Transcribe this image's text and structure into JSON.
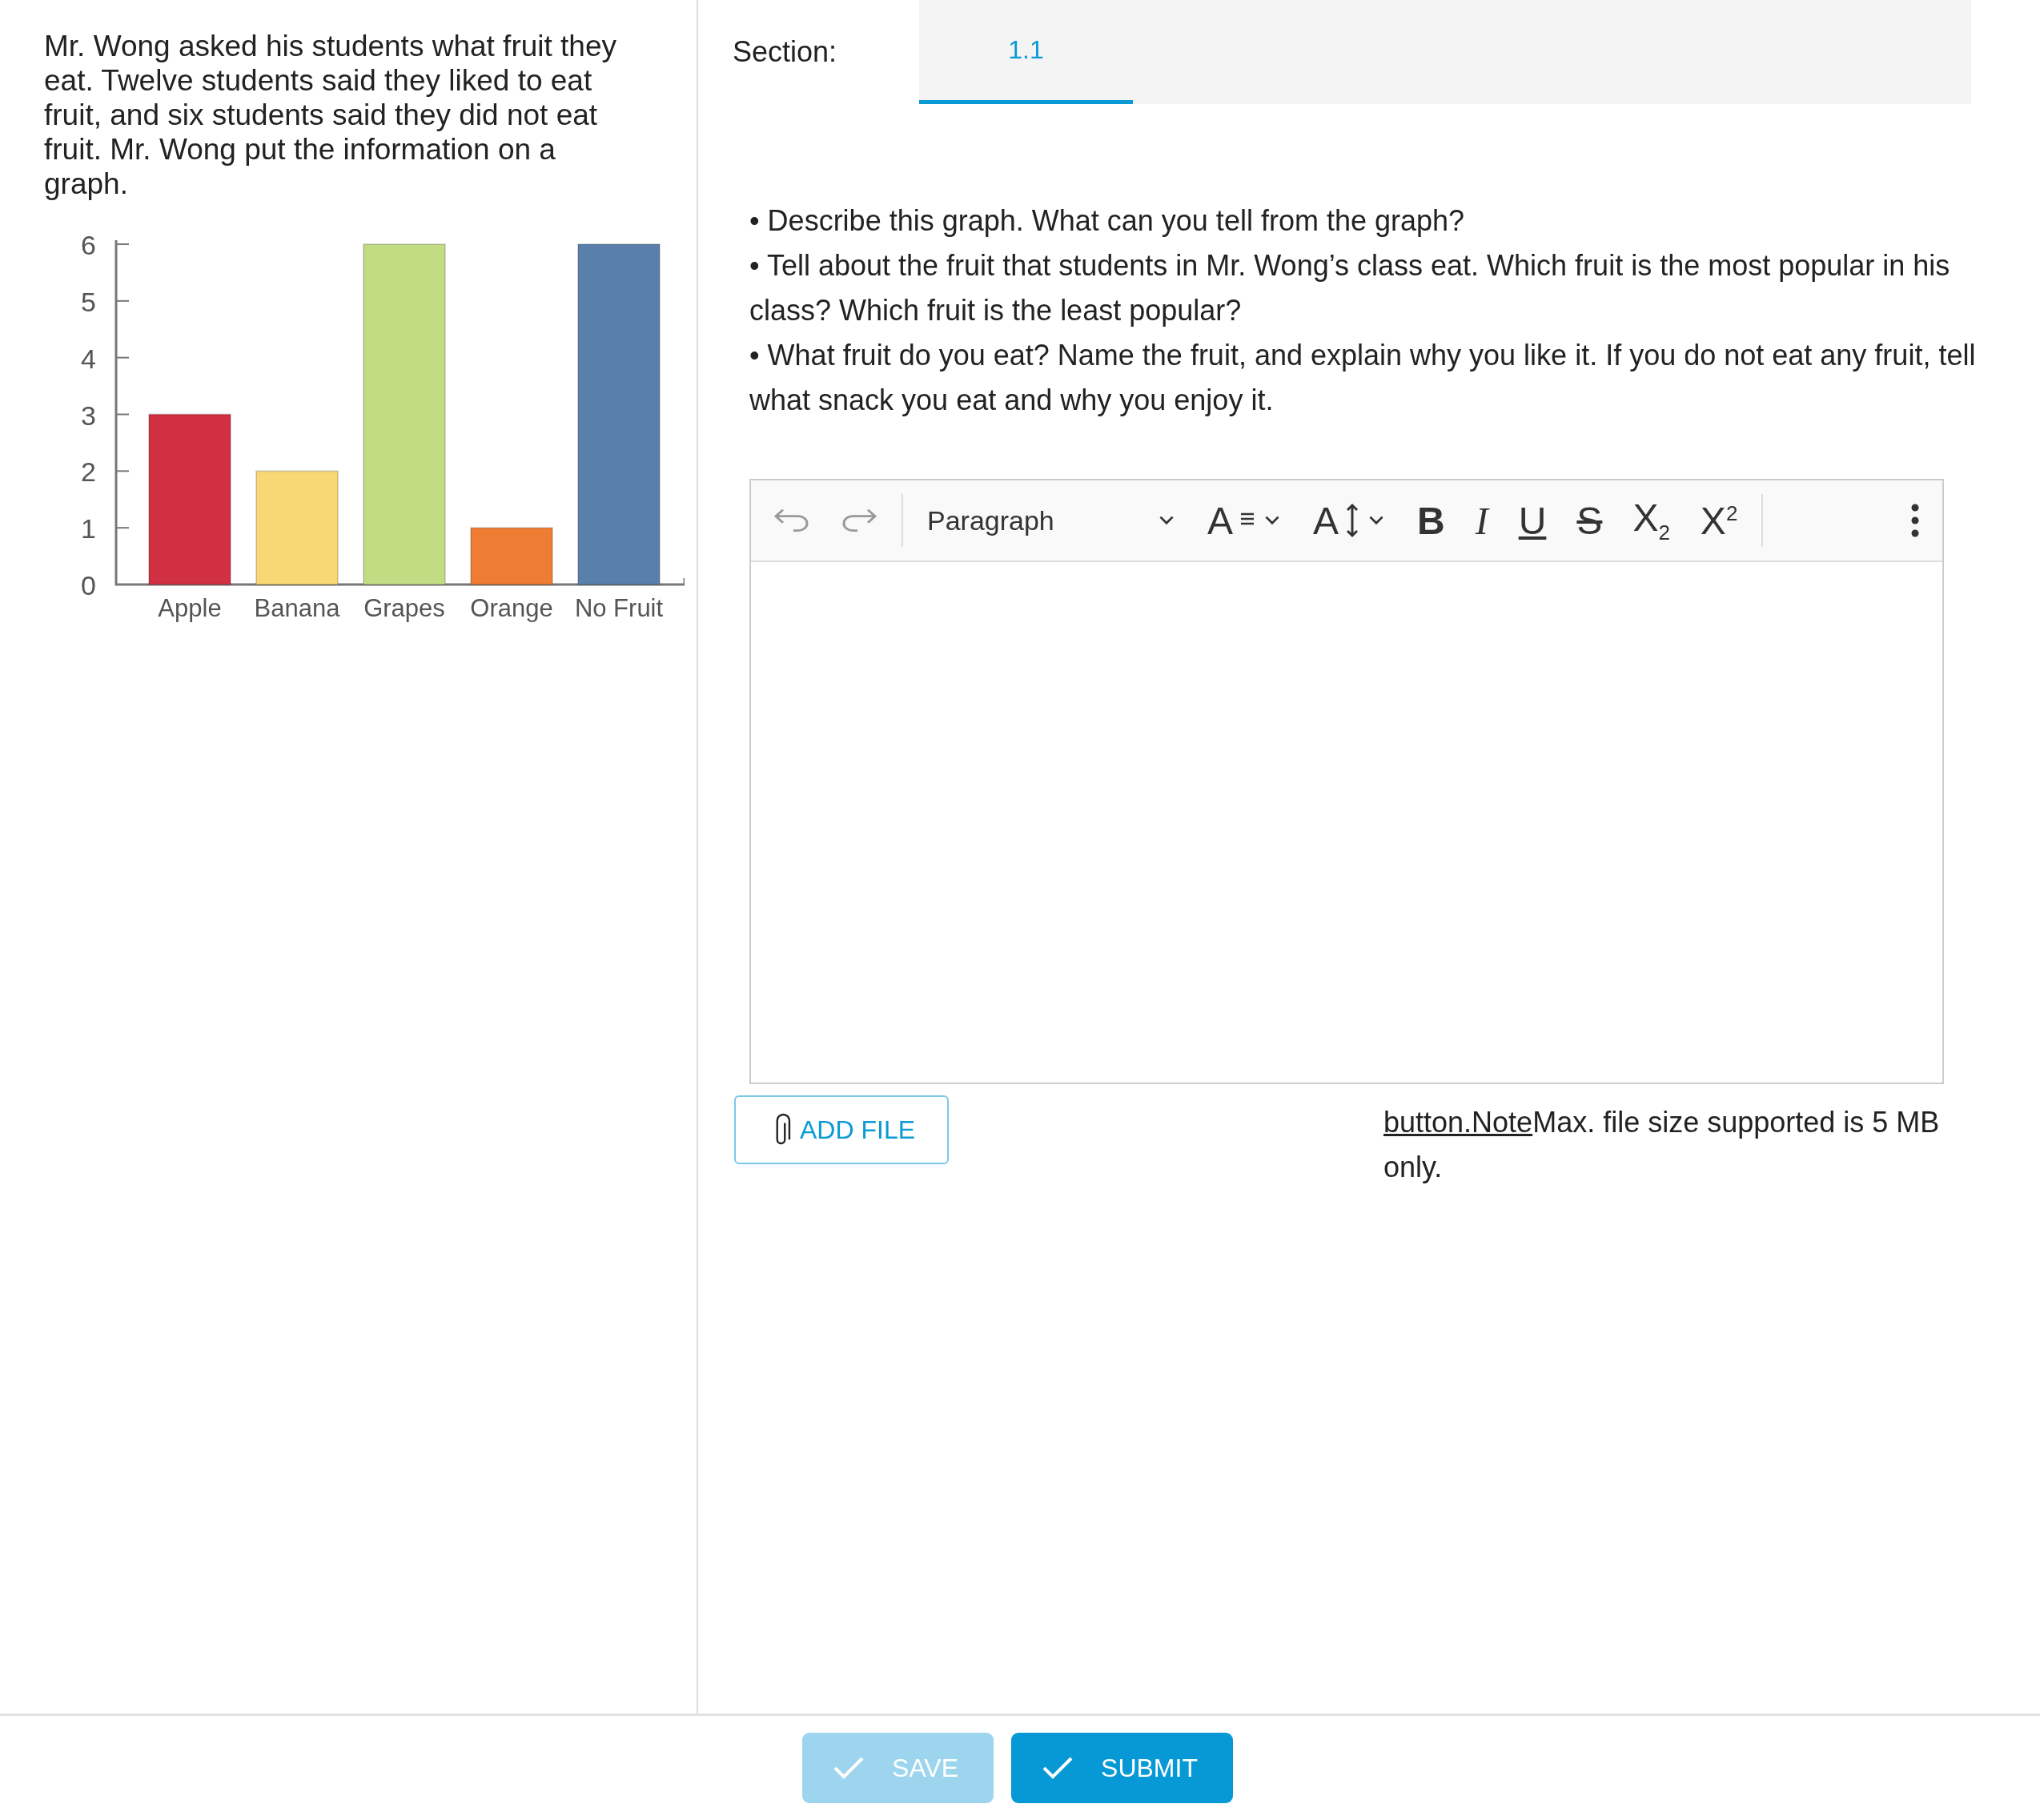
{
  "question": {
    "text": "Mr. Wong asked his students what fruit they eat. Twelve students said they liked to eat fruit, and six students said they did not eat fruit. Mr. Wong put the information on a graph.",
    "chart_data": {
      "type": "bar",
      "categories": [
        "Apple",
        "Banana",
        "Grapes",
        "Orange",
        "No Fruit"
      ],
      "values": [
        3,
        2,
        6,
        1,
        6
      ],
      "colors": [
        "#d12f42",
        "#f8d774",
        "#c2dc84",
        "#ef7c33",
        "#5a7fad"
      ],
      "ylim": [
        0,
        6
      ],
      "yticks": [
        0,
        1,
        2,
        3,
        4,
        5,
        6
      ]
    }
  },
  "section": {
    "label": "Section:",
    "tabs": [
      {
        "label": "1.1",
        "selected": true
      }
    ]
  },
  "prompt": [
    "• Describe this graph. What can you tell from the graph?",
    "• Tell about the fruit that students in Mr. Wong’s class eat. Which fruit is the most popular in his class? Which fruit is the least popular?",
    "• What fruit do you eat? Name the fruit, and explain why you like it. If you do not eat any fruit, tell what snack you eat and why you enjoy it."
  ],
  "editor": {
    "toolbar": [
      {
        "kind": "undo"
      },
      {
        "kind": "redo"
      },
      {
        "kind": "separator"
      },
      {
        "kind": "dropdown",
        "label": "Paragraph"
      },
      {
        "kind": "font-size",
        "label": "A"
      },
      {
        "kind": "line-height",
        "label": "A"
      },
      {
        "kind": "bold",
        "label": "B"
      },
      {
        "kind": "italic",
        "label": "I"
      },
      {
        "kind": "underline",
        "label": "U"
      },
      {
        "kind": "strike",
        "label": "S"
      },
      {
        "kind": "subscript",
        "label": "X$_{2}$"
      },
      {
        "kind": "superscript",
        "label": "X$^{2}$"
      },
      {
        "kind": "separator"
      },
      {
        "kind": "more"
      }
    ]
  },
  "upload": {
    "button": "ADD FILE",
    "note_link": "button.Note",
    "note": "Max. file size supported is 5 MB only."
  },
  "actions": [
    {
      "label": "SAVE",
      "disabled": true
    },
    {
      "label": "SUBMIT",
      "disabled": false
    }
  ]
}
